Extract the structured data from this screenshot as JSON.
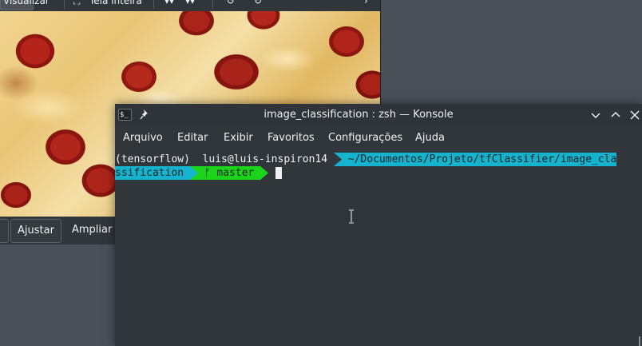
{
  "viewer": {
    "toolbar": {
      "visualize_label": "Visualizar",
      "fullscreen_label": "Tela inteira"
    },
    "image_description_icon": "pizza-photo",
    "bottombar": {
      "fit_label": "Ajustar",
      "zoom_label": "Ampliar a"
    }
  },
  "konsole": {
    "title": "image_classification : zsh — Konsole",
    "menu": [
      "Arquivo",
      "Editar",
      "Exibir",
      "Favoritos",
      "Configurações",
      "Ajuda"
    ],
    "prompt": {
      "env": "(tensorflow)",
      "user_host": "luis@luis-inspiron14",
      "path_part1": "~/Documentos/Projeto/tfClassifier/image_cla",
      "path_part2": "ssification",
      "branch_symbol": "ᚠ",
      "branch": "master"
    }
  },
  "colors": {
    "prompt_path_bg": "#15b3ce",
    "prompt_git_bg": "#1cd31c",
    "terminal_bg": "#31363b",
    "text": "#eff0f1"
  }
}
